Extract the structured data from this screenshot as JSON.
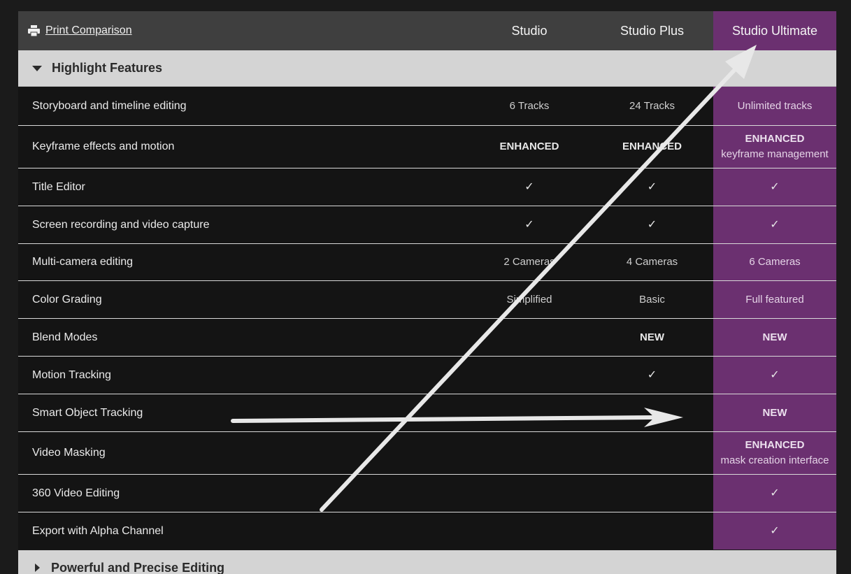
{
  "header": {
    "print_label": "Print Comparison",
    "columns": [
      "Studio",
      "Studio Plus",
      "Studio Ultimate"
    ]
  },
  "colors": {
    "accent": "#6b3070",
    "header_bg": "#3f3f3f",
    "section_bg": "#d4d4d4",
    "table_bg": "#141414"
  },
  "sections": [
    {
      "label": "Highlight Features",
      "expanded": true,
      "rows": [
        {
          "feature": "Storyboard and timeline editing",
          "cells": [
            {
              "text": "6 Tracks"
            },
            {
              "text": "24 Tracks"
            },
            {
              "text": "Unlimited tracks"
            }
          ]
        },
        {
          "feature": "Keyframe effects and motion",
          "cells": [
            {
              "bold": "ENHANCED"
            },
            {
              "bold": "ENHANCED"
            },
            {
              "bold": "ENHANCED",
              "text": "keyframe management"
            }
          ]
        },
        {
          "feature": "Title Editor",
          "cells": [
            {
              "check": "✓"
            },
            {
              "check": "✓"
            },
            {
              "check": "✓"
            }
          ]
        },
        {
          "feature": "Screen recording and video capture",
          "cells": [
            {
              "check": "✓"
            },
            {
              "check": "✓"
            },
            {
              "check": "✓"
            }
          ]
        },
        {
          "feature": "Multi-camera editing",
          "cells": [
            {
              "text": "2 Cameras"
            },
            {
              "text": "4 Cameras"
            },
            {
              "text": "6 Cameras"
            }
          ]
        },
        {
          "feature": "Color Grading",
          "cells": [
            {
              "text": "Simplified"
            },
            {
              "text": "Basic"
            },
            {
              "text": "Full featured"
            }
          ]
        },
        {
          "feature": "Blend Modes",
          "cells": [
            {},
            {
              "bold": "NEW"
            },
            {
              "bold": "NEW"
            }
          ]
        },
        {
          "feature": "Motion Tracking",
          "cells": [
            {},
            {
              "check": "✓"
            },
            {
              "check": "✓"
            }
          ]
        },
        {
          "feature": "Smart Object Tracking",
          "cells": [
            {},
            {},
            {
              "bold": "NEW"
            }
          ]
        },
        {
          "feature": "Video Masking",
          "cells": [
            {},
            {},
            {
              "bold": "ENHANCED",
              "text": "mask creation interface"
            }
          ]
        },
        {
          "feature": "360 Video Editing",
          "cells": [
            {},
            {},
            {
              "check": "✓"
            }
          ]
        },
        {
          "feature": "Export with Alpha Channel",
          "cells": [
            {},
            {},
            {
              "check": "✓"
            }
          ]
        }
      ]
    },
    {
      "label": "Powerful and Precise Editing",
      "expanded": false
    }
  ],
  "icons": {
    "print": "printer-icon",
    "expanded": "triangle-down-icon",
    "collapsed": "triangle-right-icon"
  }
}
